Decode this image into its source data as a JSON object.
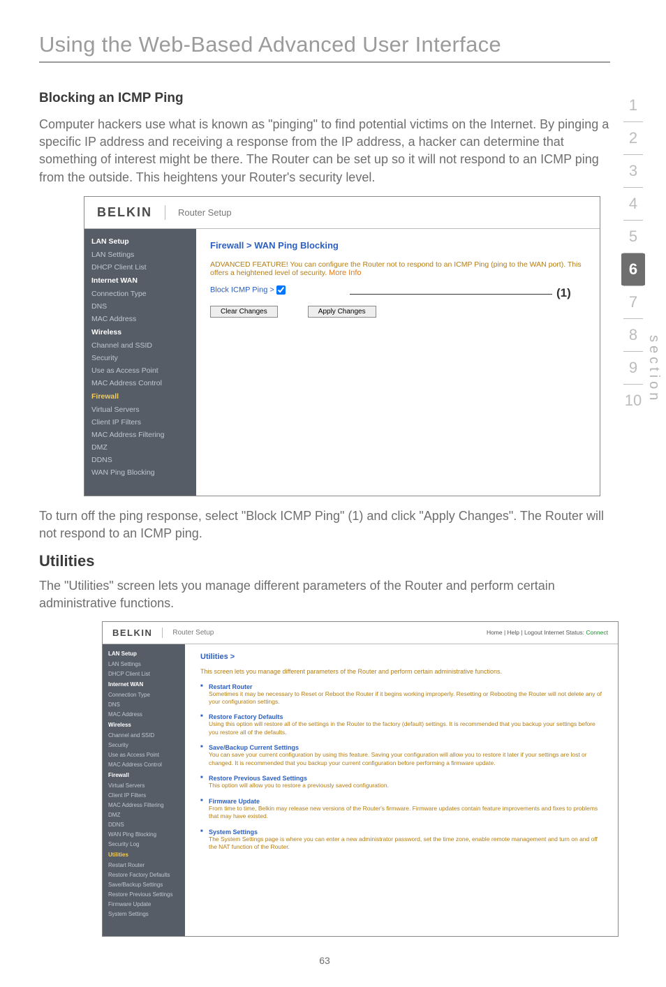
{
  "page": {
    "title": "Using the Web-Based Advanced User Interface",
    "blocking_heading": "Blocking an ICMP Ping",
    "blocking_body": "Computer hackers use what is known as \"pinging\" to find potential victims on the Internet. By pinging a specific IP address and receiving a response from the IP address, a hacker can determine that something of interest might be there. The Router can be set up so it will not respond to an ICMP ping from the outside. This heightens your Router's security level.",
    "after_ss1": "To turn off the ping response, select \"Block ICMP Ping\" (1) and click \"Apply Changes\". The Router will not respond to an ICMP ping.",
    "utilities_heading": "Utilities",
    "utilities_body": "The \"Utilities\" screen lets you manage different parameters of the Router and perform certain administrative functions.",
    "page_number": "63"
  },
  "sections": [
    "1",
    "2",
    "3",
    "4",
    "5",
    "6",
    "7",
    "8",
    "9",
    "10"
  ],
  "section_label": "section",
  "active_section_index": 5,
  "callout1": "(1)",
  "ss1": {
    "brand": "BELKIN",
    "title": "Router Setup",
    "sidebar": {
      "lan_setup": "LAN Setup",
      "lan_settings": "LAN Settings",
      "dhcp": "DHCP Client List",
      "internet_wan": "Internet WAN",
      "conn_type": "Connection Type",
      "dns": "DNS",
      "mac": "MAC Address",
      "wireless": "Wireless",
      "chan": "Channel and SSID",
      "security": "Security",
      "ap": "Use as Access Point",
      "mac_ctrl": "MAC Address Control",
      "firewall": "Firewall",
      "vsrv": "Virtual Servers",
      "cipf": "Client IP Filters",
      "macf": "MAC Address Filtering",
      "dmz": "DMZ",
      "ddns": "DDNS",
      "wanpb": "WAN Ping Blocking"
    },
    "main": {
      "crumb": "Firewall > WAN Ping Blocking",
      "adv": "ADVANCED FEATURE! You can configure the Router not to respond to an ICMP Ping (ping to the WAN port). This offers a heightened level of security. ",
      "more_info": "More Info",
      "chk_label": "Block ICMP Ping >",
      "btn_clear": "Clear Changes",
      "btn_apply": "Apply Changes"
    }
  },
  "ss2": {
    "brand": "BELKIN",
    "title": "Router Setup",
    "status_prefix": "Home | Help | Logout   Internet Status: ",
    "status_conn": "Connect",
    "sidebar": {
      "lan_setup": "LAN Setup",
      "lan_settings": "LAN Settings",
      "dhcp": "DHCP Client List",
      "internet_wan": "Internet WAN",
      "conn_type": "Connection Type",
      "dns": "DNS",
      "mac": "MAC Address",
      "wireless": "Wireless",
      "chan": "Channel and SSID",
      "security": "Security",
      "ap": "Use as Access Point",
      "mac_ctrl": "MAC Address Control",
      "firewall": "Firewall",
      "vsrv": "Virtual Servers",
      "cipf": "Client IP Filters",
      "macf": "MAC Address Filtering",
      "dmz": "DMZ",
      "ddns": "DDNS",
      "wanpb": "WAN Ping Blocking",
      "seclog": "Security Log",
      "utilities": "Utilities",
      "restart": "Restart Router",
      "rfd": "Restore Factory Defaults",
      "sbs": "Save/Backup Settings",
      "rps": "Restore Previous Settings",
      "fwu": "Firmware Update",
      "sys": "System Settings"
    },
    "main": {
      "crumb": "Utilities >",
      "intro": "This screen lets you manage different parameters of the Router and perform certain administrative functions.",
      "items": [
        {
          "title": "Restart Router",
          "desc": "Sometimes it may be necessary to Reset or Reboot the Router if it begins working improperly. Resetting or Rebooting the Router will not delete any of your configuration settings."
        },
        {
          "title": "Restore Factory Defaults",
          "desc": "Using this option will restore all of the settings in the Router to the factory (default) settings. It is recommended that you backup your settings before you restore all of the defaults."
        },
        {
          "title": "Save/Backup Current Settings",
          "desc": "You can save your current configuration by using this feature. Saving your configuration will allow you to restore it later if your settings are lost or changed. It is recommended that you backup your current configuration before performing a firmware update."
        },
        {
          "title": "Restore Previous Saved Settings",
          "desc": "This option will allow you to restore a previously saved configuration."
        },
        {
          "title": "Firmware Update",
          "desc": "From time to time, Belkin may release new versions of the Router's firmware. Firmware updates contain feature improvements and fixes to problems that may have existed."
        },
        {
          "title": "System Settings",
          "desc": "The System Settings page is where you can enter a new administrator password, set the time zone, enable remote management and turn on and off the NAT function of the Router."
        }
      ]
    }
  }
}
